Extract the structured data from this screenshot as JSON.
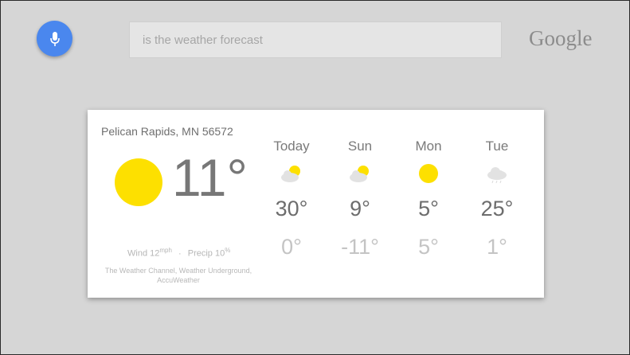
{
  "search": {
    "query": "is the weather forecast"
  },
  "brand": {
    "logo": "Google"
  },
  "icons": {
    "mic": "mic-icon",
    "sun": "sun-icon",
    "partly_cloudy": "partly-cloudy-icon",
    "cloudy": "cloudy-icon"
  },
  "colors": {
    "mic_bg": "#4a87ee",
    "sun": "#fde000",
    "card": "#ffffff",
    "background": "#d6d6d6"
  },
  "weather": {
    "location": "Pelican Rapids, MN 56572",
    "current_temp": "11°",
    "wind_label": "Wind",
    "wind_value": "12",
    "wind_unit": "mph",
    "precip_label": "Precip",
    "precip_value": "10",
    "precip_unit": "%",
    "sources": "The Weather Channel, Weather Underground, AccuWeather",
    "forecast": [
      {
        "day": "Today",
        "icon": "partly-cloudy-icon",
        "high": "30°",
        "low": "0°"
      },
      {
        "day": "Sun",
        "icon": "partly-cloudy-icon",
        "high": "9°",
        "low": "-11°"
      },
      {
        "day": "Mon",
        "icon": "sun-icon",
        "high": "5°",
        "low": "5°"
      },
      {
        "day": "Tue",
        "icon": "cloudy-icon",
        "high": "25°",
        "low": "1°"
      }
    ]
  }
}
